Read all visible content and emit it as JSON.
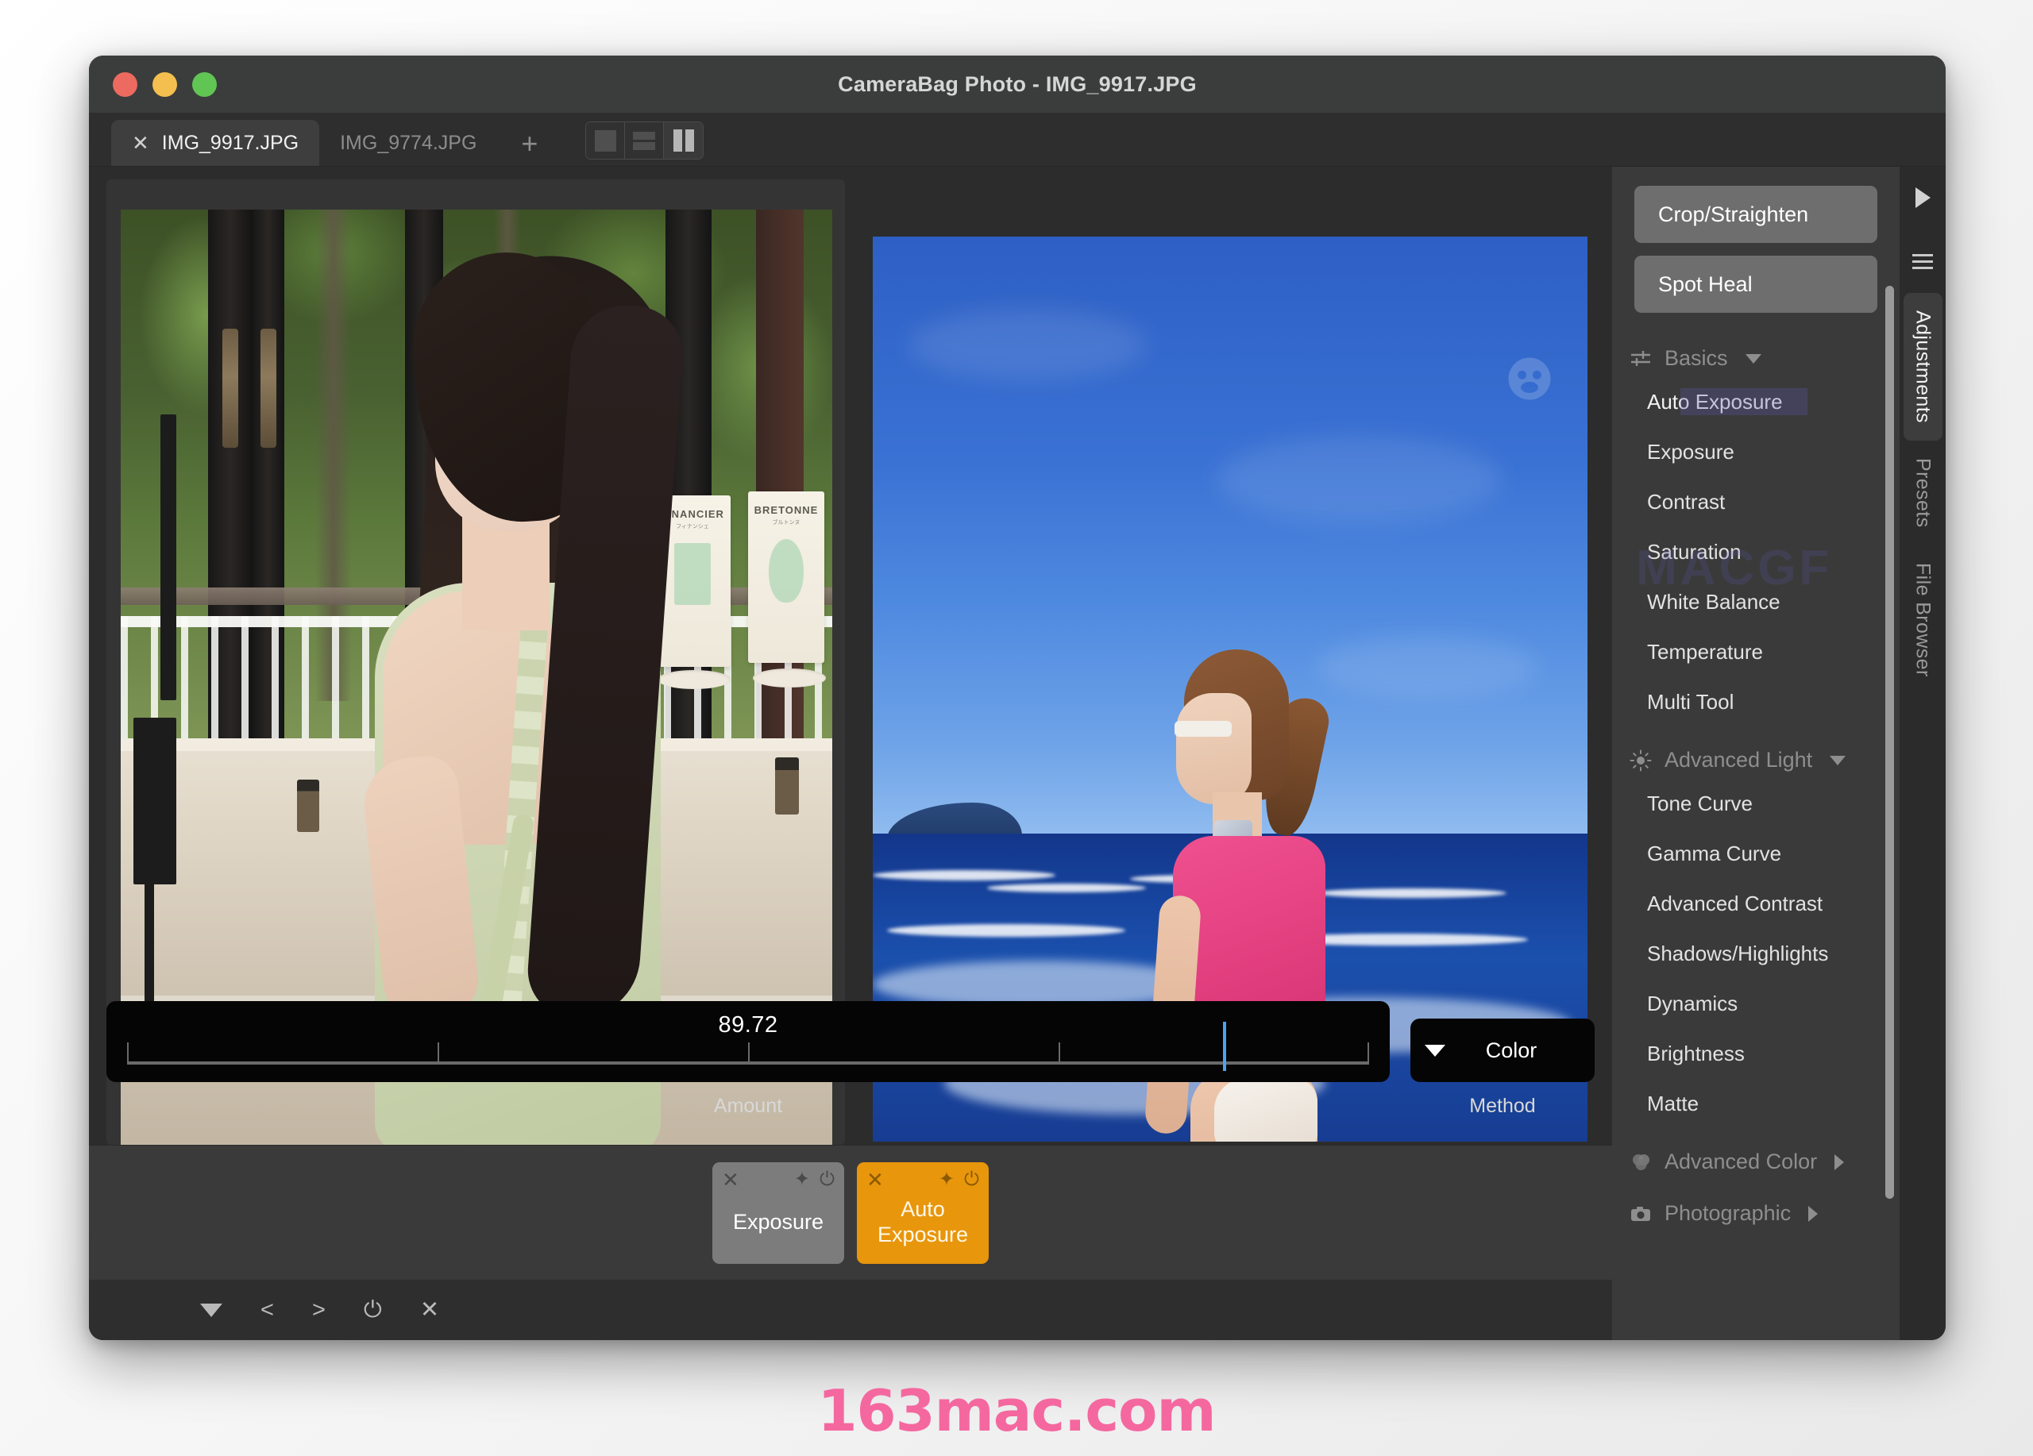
{
  "window": {
    "title": "CameraBag Photo - IMG_9917.JPG",
    "traffic_lights": [
      "close",
      "minimize",
      "zoom"
    ]
  },
  "tabs": {
    "items": [
      {
        "label": "IMG_9917.JPG",
        "active": true,
        "close": "✕"
      },
      {
        "label": "IMG_9774.JPG",
        "active": false
      }
    ],
    "add_label": "+",
    "view_modes": [
      {
        "name": "single-view",
        "active": false
      },
      {
        "name": "horizontal-split-view",
        "active": false
      },
      {
        "name": "vertical-split-view",
        "active": true
      }
    ]
  },
  "slider": {
    "value": "89.72",
    "label": "Amount",
    "handle_percent": 87,
    "tick_percents": [
      0,
      25,
      50,
      75,
      100
    ]
  },
  "method": {
    "value": "Color",
    "label": "Method",
    "caret": "▼"
  },
  "chips": [
    {
      "label": "Exposure",
      "color": "gray",
      "close": "✕",
      "pin": "✦",
      "power": "⏻"
    },
    {
      "label": "Auto\nExposure",
      "label_line1": "Auto",
      "label_line2": "Exposure",
      "color": "orange",
      "close": "✕",
      "pin": "✦",
      "power": "⏻"
    }
  ],
  "statusbar": {
    "icons": [
      "caret-down",
      "prev",
      "next",
      "power",
      "close"
    ],
    "prev": "<",
    "next": ">",
    "power": "⏻",
    "close": "✕"
  },
  "sidebar": {
    "buttons": [
      {
        "label": "Crop/Straighten"
      },
      {
        "label": "Spot Heal"
      }
    ],
    "groups": [
      {
        "label": "Basics",
        "icon": "sliders-icon",
        "expanded": true,
        "items": [
          {
            "label": "Auto Exposure",
            "selected": true
          },
          {
            "label": "Exposure"
          },
          {
            "label": "Contrast"
          },
          {
            "label": "Saturation"
          },
          {
            "label": "White Balance"
          },
          {
            "label": "Temperature"
          },
          {
            "label": "Multi Tool"
          }
        ]
      },
      {
        "label": "Advanced Light",
        "icon": "sun-icon",
        "expanded": true,
        "items": [
          {
            "label": "Tone Curve"
          },
          {
            "label": "Gamma Curve"
          },
          {
            "label": "Advanced Contrast"
          },
          {
            "label": "Shadows/Highlights"
          },
          {
            "label": "Dynamics"
          },
          {
            "label": "Brightness"
          },
          {
            "label": "Matte"
          }
        ]
      },
      {
        "label": "Advanced Color",
        "icon": "venn-icon",
        "expanded": false,
        "items": []
      },
      {
        "label": "Photographic",
        "icon": "camera-icon",
        "expanded": false,
        "items": []
      }
    ],
    "ghost_watermark": "MACGF"
  },
  "vertical_tabs": {
    "play": "▶",
    "items": [
      {
        "label": "Adjustments",
        "active": true
      },
      {
        "label": "Presets",
        "active": false
      },
      {
        "label": "File Browser",
        "active": false
      }
    ]
  },
  "photos": {
    "left": {
      "name": "indoor-portrait",
      "product_boxes": [
        {
          "title": "FINANCIER",
          "sub": "フィナンシェ"
        },
        {
          "title": "BRETONNE",
          "sub": "ブルトンヌ"
        }
      ]
    },
    "right": {
      "name": "beach-portrait"
    }
  },
  "watermark": {
    "text": "163mac.com",
    "color": "#f4689f"
  }
}
